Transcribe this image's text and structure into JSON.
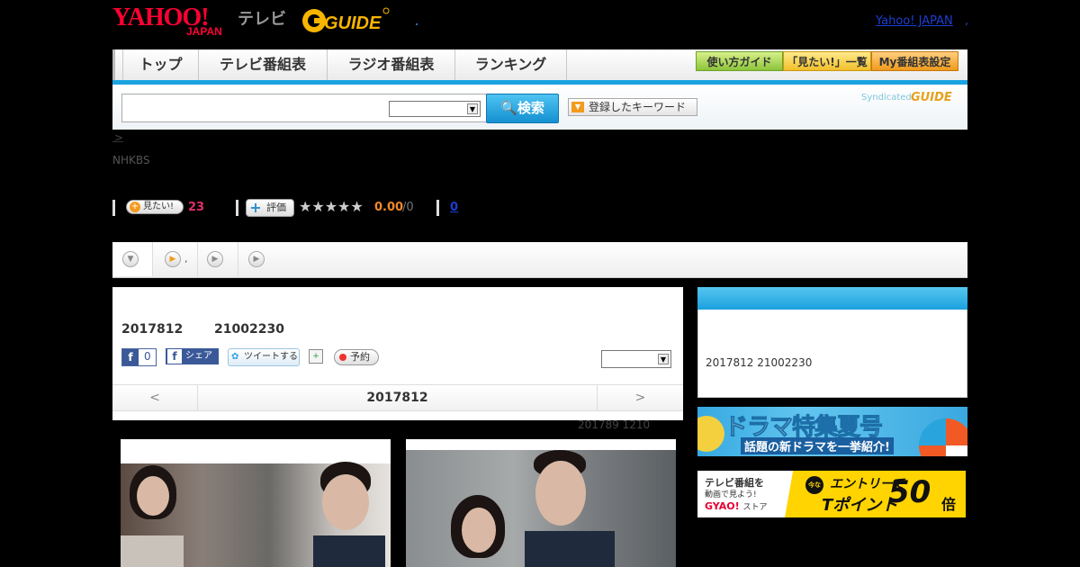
{
  "header": {
    "yahoo_logo": "YAHOO!",
    "yahoo_logo_sub": "JAPAN",
    "tv_label": "テレビ",
    "gguide_logo": "GUIDE",
    "yahoo_japan_link": "Yahoo! JAPAN",
    "link_sep": ","
  },
  "nav": {
    "tabs": [
      "トップ",
      "テレビ番組表",
      "ラジオ番組表",
      "ランキング"
    ],
    "guide_button": "使い方ガイド",
    "want_list_button": "「見たい!」一覧",
    "my_schedule_button": "My番組表設定"
  },
  "search": {
    "input_value": "",
    "select_value": "",
    "button_label": "検索",
    "keyword_button": "登録したキーワード",
    "syndicated": "Syndicated",
    "syndicated_logo": "GUIDE"
  },
  "breadcrumb": {
    "arrow": ">"
  },
  "program": {
    "channel": "NHKBS",
    "want_label": "見たい!",
    "want_count": "23",
    "rate_label": "評価",
    "stars": "★★★★★",
    "score": "0.00",
    "score_total": "/0",
    "comment_count": "0"
  },
  "tabs": {
    "tab2_suffix": ","
  },
  "detail": {
    "date": "2017812",
    "time": "21002230",
    "fb_like_count": "0",
    "fb_share_label": "シェア",
    "tweet_label": "ツイートする",
    "reserve_label": "予約",
    "select_value": "",
    "prev_label": "<",
    "current_date": "2017812",
    "next_label": ">",
    "airdate": "201789  1210"
  },
  "sidebar": {
    "info": "2017812  21002230"
  },
  "banners": {
    "drama_title": "ドラマ特集夏号",
    "drama_sub": "話題の新ドラマを一挙紹介!",
    "gyao_line1": "テレビ番組を",
    "gyao_line2": "動画で見よう!",
    "gyao_brand": "GYAO!",
    "gyao_store": "ストア",
    "gyao_badge": "今なら",
    "gyao_entry": "エントリーで",
    "gyao_tpoint": "Tポイント",
    "gyao_50": "50",
    "gyao_bai": "倍"
  }
}
